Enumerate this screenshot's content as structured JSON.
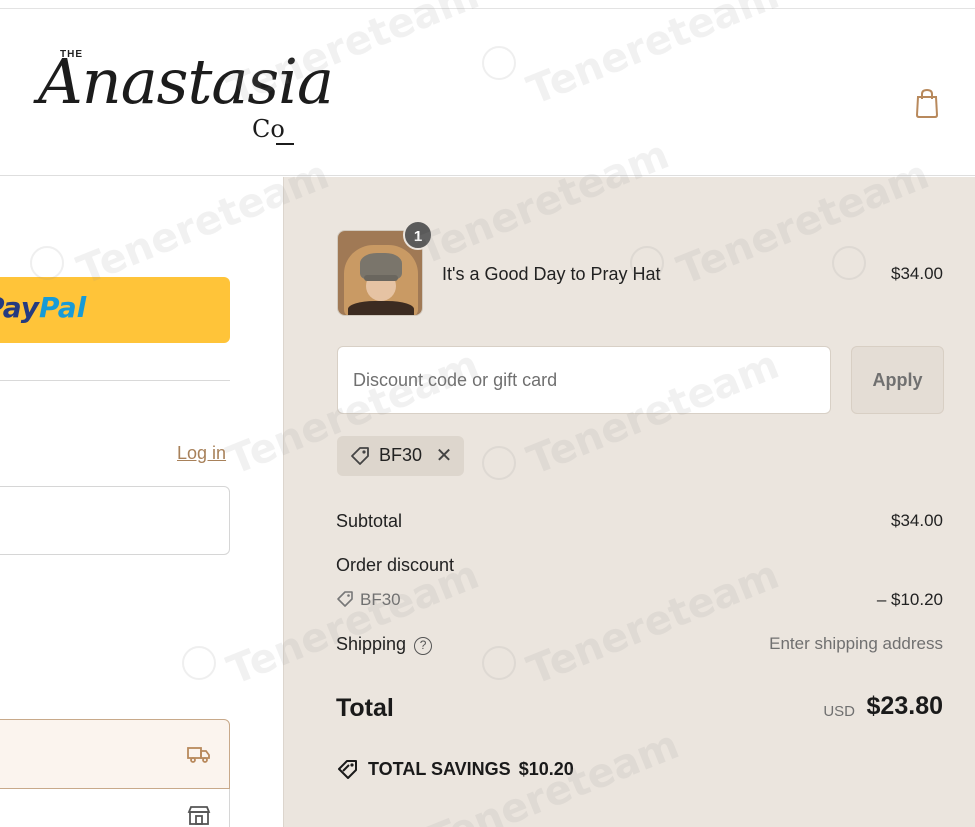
{
  "header": {
    "logo_small": "THE",
    "logo_main": "Anastasia",
    "logo_suffix": "Co",
    "cart_icon": "shopping-bag-icon"
  },
  "express_checkout": {
    "paypal_part1": "Pay",
    "paypal_part2": "Pal"
  },
  "contact": {
    "login_link": "Log in"
  },
  "delivery": {
    "ship_icon": "truck-icon",
    "pickup_icon": "store-icon"
  },
  "order": {
    "item": {
      "name": "It's a Good Day to Pray Hat",
      "price": "$34.00",
      "quantity": "1"
    },
    "discount": {
      "placeholder": "Discount code or gift card",
      "apply_label": "Apply",
      "applied_code": "BF30",
      "remove_label": "✕"
    },
    "summary": {
      "subtotal_label": "Subtotal",
      "subtotal_value": "$34.00",
      "order_discount_label": "Order discount",
      "discount_code": "BF30",
      "discount_value": "– $10.20",
      "shipping_label": "Shipping",
      "shipping_value": "Enter shipping address",
      "total_label": "Total",
      "currency": "USD",
      "total_value": "$23.80",
      "savings_label": "TOTAL SAVINGS",
      "savings_value": "$10.20"
    }
  },
  "watermark": "Tenereteam",
  "colors": {
    "paypal_yellow": "#ffc439",
    "summary_bg": "#ebe5de",
    "link_brown": "#a8815a",
    "ship_option_bg": "#fbf4ee"
  }
}
